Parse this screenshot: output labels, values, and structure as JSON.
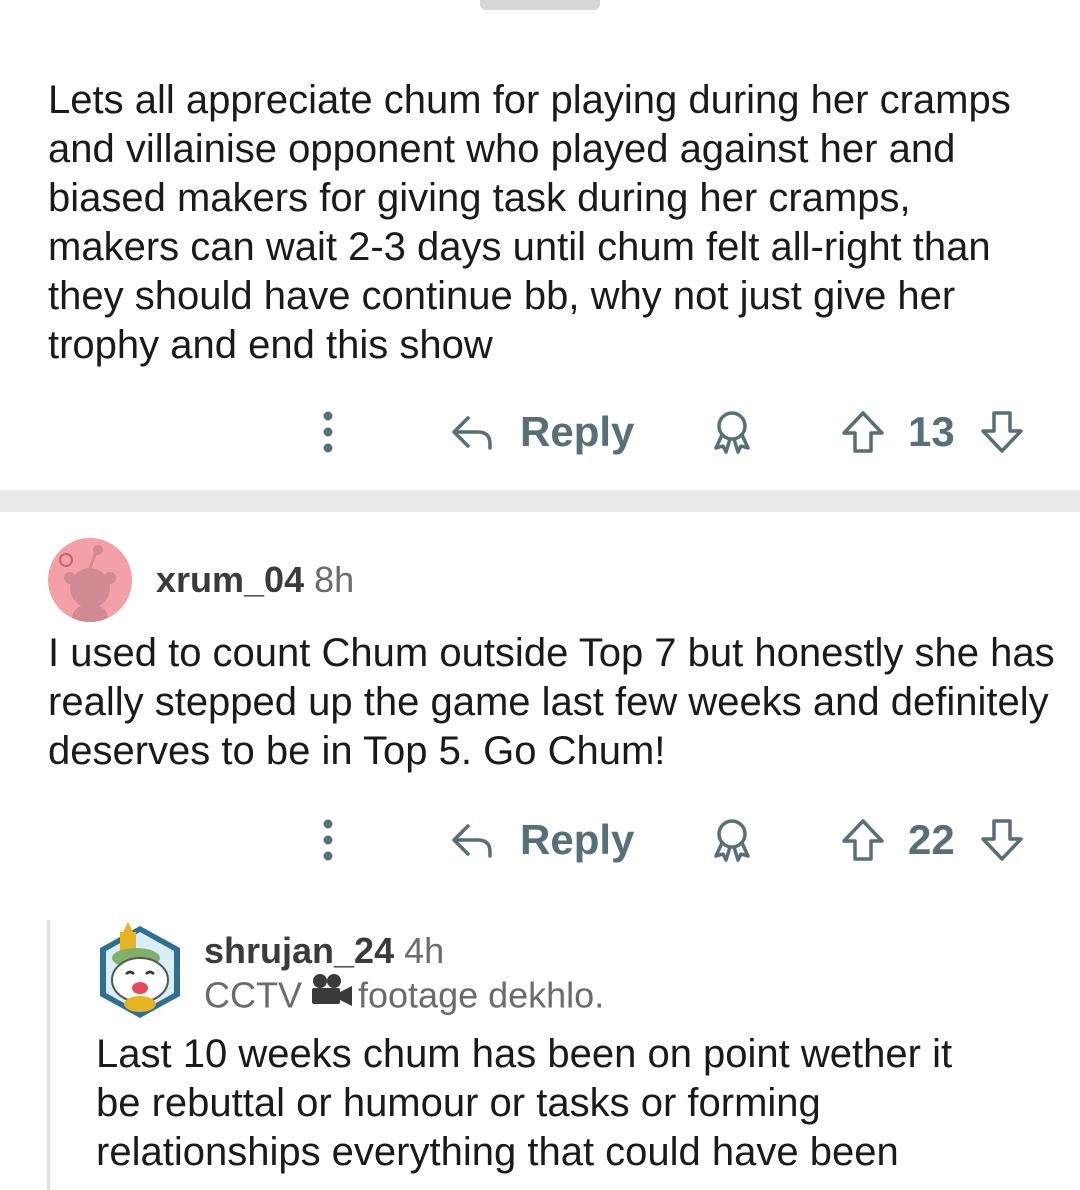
{
  "comments": [
    {
      "body": "Lets all appreciate chum for playing during her cramps and villainise opponent who played against her and  biased makers for giving task during her cramps, makers can wait 2-3 days until chum felt all-right than they should have continue bb, why not just give her trophy and end this show",
      "reply_label": "Reply",
      "votes": "13"
    },
    {
      "username": "xrum_04",
      "time": "8h",
      "body": "I used to count Chum outside Top 7 but honestly she has really stepped up the game last few weeks and definitely deserves to be in Top 5. Go Chum!",
      "reply_label": "Reply",
      "votes": "22"
    },
    {
      "username": "shrujan_24",
      "time": "4h",
      "flair_prefix": "CCTV",
      "flair_icon": "video-camera",
      "flair_suffix": "footage dekhlo.",
      "body": "Last 10 weeks chum has been on point wether it be rebuttal or humour or tasks or forming relationships everything that could have been"
    }
  ],
  "colors": {
    "text": "#1a1a1b",
    "action": "#576f76",
    "separator": "#eaeaec",
    "avatar_bg": "#f4a0a8"
  },
  "icons": {
    "more": "more-vertical-icon",
    "reply": "reply-arrow-icon",
    "award": "award-icon",
    "upvote": "upvote-arrow-icon",
    "downvote": "downvote-arrow-icon"
  }
}
